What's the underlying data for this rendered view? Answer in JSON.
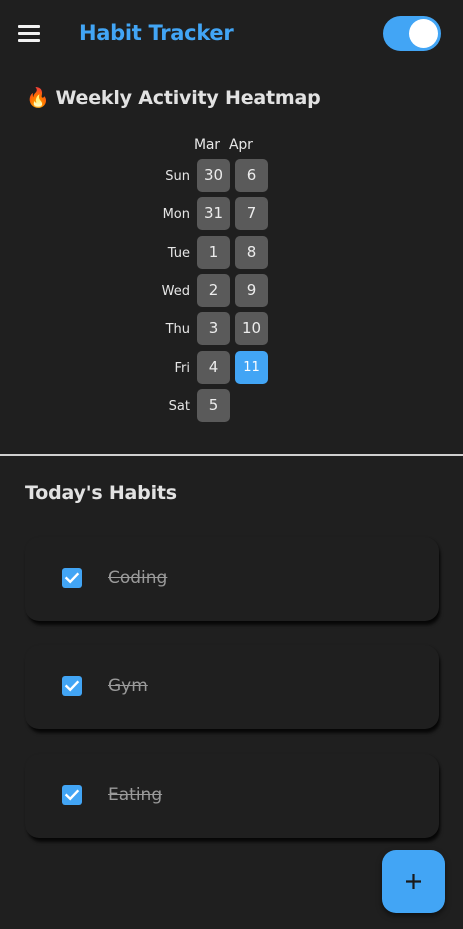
{
  "app": {
    "title": "Habit Tracker",
    "menu_icon": "menu-icon",
    "theme_toggle_on": true
  },
  "heatmap": {
    "title": "Weekly Activity Heatmap",
    "title_icon": "🔥",
    "months": [
      "Mar",
      "Apr"
    ],
    "day_labels": [
      "Sun",
      "Mon",
      "Tue",
      "Wed",
      "Thu",
      "Fri",
      "Sat"
    ],
    "week1": [
      "30",
      "31",
      "1",
      "2",
      "3",
      "4",
      "5"
    ],
    "week2": [
      "6",
      "7",
      "8",
      "9",
      "10",
      "11"
    ],
    "active_day": "11"
  },
  "habits": {
    "title": "Today's Habits",
    "items": [
      {
        "name": "Coding",
        "done": true
      },
      {
        "name": "Gym",
        "done": true
      },
      {
        "name": "Eating",
        "done": true
      }
    ]
  },
  "fab": {
    "label": "+",
    "icon": "plus-icon"
  },
  "colors": {
    "accent": "#42a5f5",
    "background": "#1f1f1f",
    "cell": "#5a5a5a"
  }
}
